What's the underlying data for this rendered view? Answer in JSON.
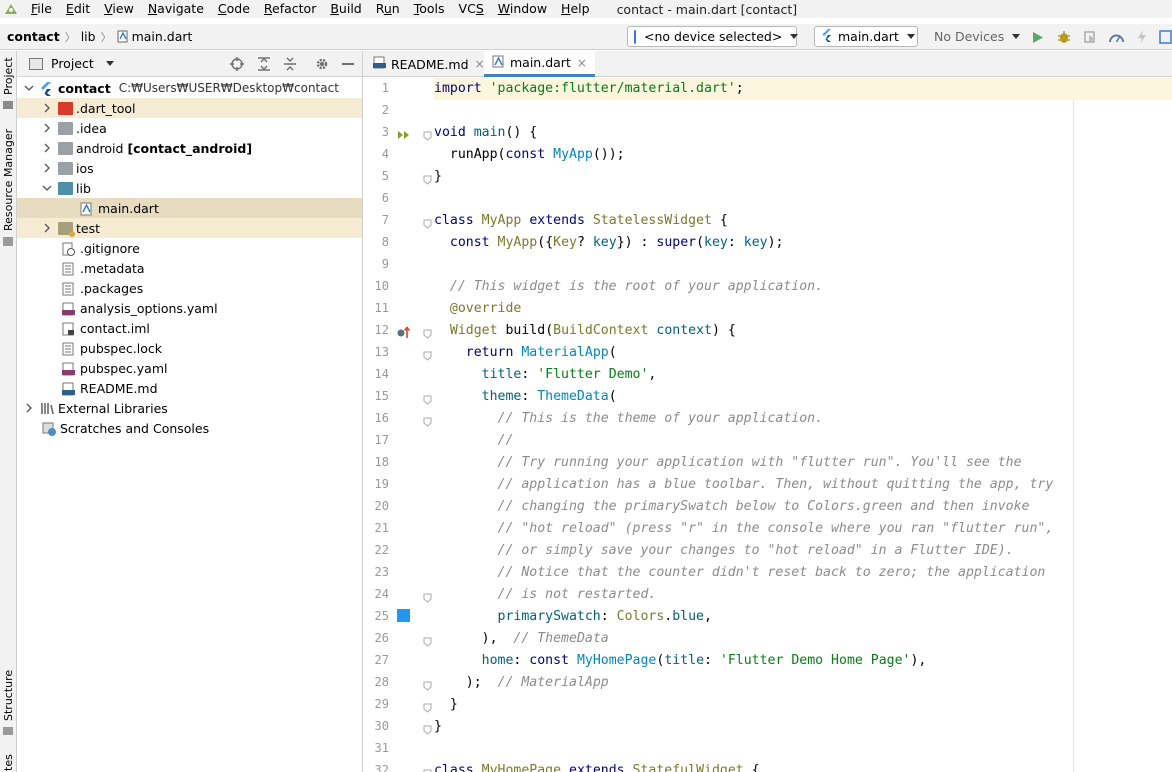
{
  "menubar": {
    "items": [
      "File",
      "Edit",
      "View",
      "Navigate",
      "Code",
      "Refactor",
      "Build",
      "Run",
      "Tools",
      "VCS",
      "Window",
      "Help"
    ],
    "mnemonics": [
      "F",
      "E",
      "V",
      "N",
      "C",
      "R",
      "B",
      "u",
      "T",
      "S",
      "W",
      "H"
    ],
    "window_title": "contact - main.dart [contact]"
  },
  "breadcrumb": {
    "project": "contact",
    "folder": "lib",
    "file": "main.dart"
  },
  "toolbar": {
    "device_selector": "<no device selected>",
    "run_config": "main.dart",
    "devices": "No Devices"
  },
  "left_strip": {
    "project_label": "Project",
    "resource_label": "Resource Manager",
    "structure_label": "Structure",
    "bottom_label": "tes"
  },
  "project_panel": {
    "title": "Project",
    "root_name": "contact",
    "root_path": "C:₩Users₩USER₩Desktop₩contact",
    "items": [
      {
        "label": ".dart_tool",
        "bold": ""
      },
      {
        "label": ".idea",
        "bold": ""
      },
      {
        "label": "android",
        "bold": "[contact_android]"
      },
      {
        "label": "ios",
        "bold": ""
      },
      {
        "label": "lib",
        "bold": ""
      },
      {
        "label": "main.dart",
        "bold": ""
      },
      {
        "label": "test",
        "bold": ""
      },
      {
        "label": ".gitignore",
        "bold": ""
      },
      {
        "label": ".metadata",
        "bold": ""
      },
      {
        "label": ".packages",
        "bold": ""
      },
      {
        "label": "analysis_options.yaml",
        "bold": ""
      },
      {
        "label": "contact.iml",
        "bold": ""
      },
      {
        "label": "pubspec.lock",
        "bold": ""
      },
      {
        "label": "pubspec.yaml",
        "bold": ""
      },
      {
        "label": "README.md",
        "bold": ""
      },
      {
        "label": "External Libraries",
        "bold": ""
      },
      {
        "label": "Scratches and Consoles",
        "bold": ""
      }
    ]
  },
  "editor": {
    "tabs": [
      {
        "label": "README.md",
        "close": "×"
      },
      {
        "label": "main.dart",
        "close": "×"
      }
    ],
    "line_numbers": [
      "1",
      "2",
      "3",
      "4",
      "5",
      "6",
      "7",
      "8",
      "9",
      "10",
      "11",
      "12",
      "13",
      "14",
      "15",
      "16",
      "17",
      "18",
      "19",
      "20",
      "21",
      "22",
      "23",
      "24",
      "25",
      "26",
      "27",
      "28",
      "29",
      "30",
      "31",
      "32"
    ],
    "code": {
      "l1_kw": "import",
      "l1_str": "'package:flutter/material.dart'",
      "l1_end": ";",
      "l3_kw": "void",
      "l3_fn": "main",
      "l3_rest": "() {",
      "l4_a": "runApp(",
      "l4_kw": "const",
      "l4_cls": "MyApp",
      "l4_end": "());",
      "l5": "}",
      "l7_kw": "class",
      "l7_cls": "MyApp",
      "l7_kw2": "extends",
      "l7_cls2": "StatelessWidget",
      "l7_end": "{",
      "l8_kw": "const",
      "l8_cls": "MyApp",
      "l8_a": "({",
      "l8_cls2": "Key",
      "l8_b": "? ",
      "l8_p": "key",
      "l8_c": "}) : ",
      "l8_kw2": "super",
      "l8_d": "(",
      "l8_p2": "key",
      "l8_e": ": ",
      "l8_p3": "key",
      "l8_f": ");",
      "l10": "// This widget is the root of your application.",
      "l11": "@override",
      "l12_cls": "Widget",
      "l12_fn": "build",
      "l12_a": "(",
      "l12_cls2": "BuildContext",
      "l12_p": "context",
      "l12_b": ") {",
      "l13_kw": "return",
      "l13_cls": "MaterialApp",
      "l13_a": "(",
      "l14_p": "title",
      "l14_a": ": ",
      "l14_str": "'Flutter Demo'",
      "l14_b": ",",
      "l15_p": "theme",
      "l15_a": ": ",
      "l15_cls": "ThemeData",
      "l15_b": "(",
      "l16": "// This is the theme of your application.",
      "l17": "//",
      "l18": "// Try running your application with \"flutter run\". You'll see the",
      "l19": "// application has a blue toolbar. Then, without quitting the app, try",
      "l20": "// changing the primarySwatch below to Colors.green and then invoke",
      "l21": "// \"hot reload\" (press \"r\" in the console where you ran \"flutter run\",",
      "l22": "// or simply save your changes to \"hot reload\" in a Flutter IDE).",
      "l23": "// Notice that the counter didn't reset back to zero; the application",
      "l24": "// is not restarted.",
      "l25_p": "primarySwatch",
      "l25_a": ": ",
      "l25_cls": "Colors",
      "l25_b": ".",
      "l25_p2": "blue",
      "l25_c": ",",
      "l26_a": "),",
      "l26_cmt": "// ThemeData",
      "l27_p": "home",
      "l27_a": ": ",
      "l27_kw": "const",
      "l27_cls": "MyHomePage",
      "l27_b": "(",
      "l27_p2": "title",
      "l27_c": ": ",
      "l27_str": "'Flutter Demo Home Page'",
      "l27_d": "),",
      "l28_a": ");",
      "l28_cmt": "// MaterialApp",
      "l29": "}",
      "l30": "}",
      "l32_kw": "class",
      "l32_cls": "MyHomePage",
      "l32_kw2": "extends",
      "l32_cls2": "StatefulWidget",
      "l32_end": "{"
    },
    "swatch_color": "#2196f3"
  },
  "colors": {
    "keyword": "#000080",
    "string": "#067d17",
    "class": "#0086c2",
    "comment": "#8c8c8c",
    "annotation": "#7a7a2b",
    "function": "#00627a",
    "selection": "#e8dcc0",
    "tab_underline": "#4083c9"
  }
}
